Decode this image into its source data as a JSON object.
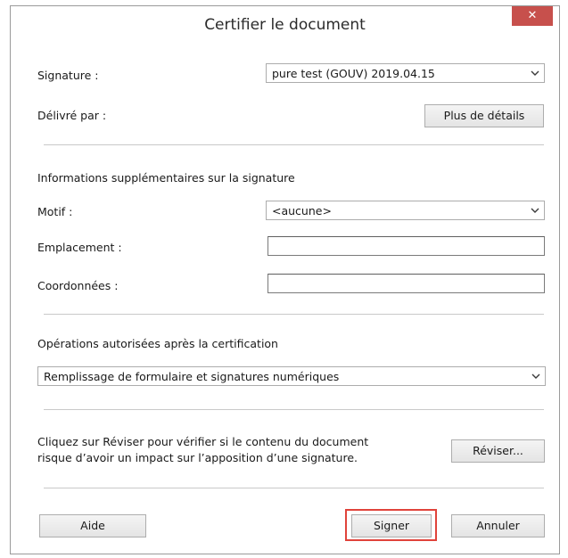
{
  "window": {
    "title": "Certifier le document",
    "close_symbol": "✕"
  },
  "signature": {
    "label": "Signature :",
    "value": "pure test (GOUV) 2019.04.15"
  },
  "issuer": {
    "label": "Délivré par :",
    "details_button": "Plus de détails"
  },
  "extra_info": {
    "heading": "Informations supplémentaires sur la signature",
    "reason_label": "Motif :",
    "reason_value": "<aucune>",
    "location_label": "Emplacement :",
    "location_value": "",
    "contact_label": "Coordonnées :",
    "contact_value": ""
  },
  "permissions": {
    "heading": "Opérations autorisées après la certification",
    "value": "Remplissage de formulaire et signatures numériques"
  },
  "review": {
    "line1": "Cliquez sur Réviser pour vérifier si le contenu du document",
    "line2": "risque d’avoir un impact sur l’apposition d’une signature.",
    "button": "Réviser..."
  },
  "footer": {
    "help_button": "Aide",
    "sign_button": "Signer",
    "cancel_button": "Annuler"
  },
  "colors": {
    "close_button": "#c7504c",
    "highlight": "#e0433b"
  }
}
